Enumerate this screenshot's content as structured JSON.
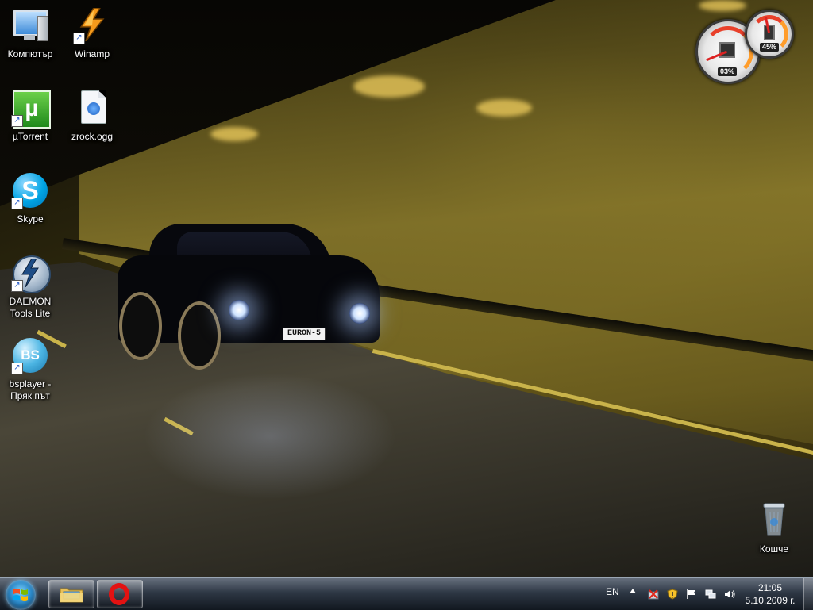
{
  "desktop": {
    "icons": [
      {
        "label": "Компютър",
        "icon": "computer-icon"
      },
      {
        "label": "Winamp",
        "icon": "winamp-icon"
      },
      {
        "label": "µTorrent",
        "icon": "utorrent-icon",
        "glyph": "µ"
      },
      {
        "label": "zrock.ogg",
        "icon": "audio-file-icon"
      },
      {
        "label": "Skype",
        "icon": "skype-icon",
        "glyph": "S"
      },
      {
        "label": "DAEMON Tools Lite",
        "icon": "daemon-tools-icon"
      },
      {
        "label": "bsplayer - Пряк път",
        "icon": "bsplayer-icon",
        "glyph": "BS"
      },
      {
        "label": "Кошче",
        "icon": "recycle-bin-icon"
      }
    ],
    "wallpaper": {
      "plate_text": "EURON-5"
    }
  },
  "gadget": {
    "cpu_value": "03%",
    "memory_value": "45%",
    "cpu_percent": 3,
    "memory_percent": 45
  },
  "taskbar": {
    "start": {
      "icon": "windows-logo-icon"
    },
    "pinned": [
      {
        "name": "Windows Explorer",
        "icon": "folder-icon"
      },
      {
        "name": "Opera",
        "icon": "opera-icon"
      }
    ],
    "language": "EN",
    "tray_icons": [
      "show-hidden-icons",
      "network-error-icon",
      "warning-shield-icon",
      "action-center-flag-icon",
      "network-icon",
      "volume-icon"
    ],
    "clock": {
      "time": "21:05",
      "date": "5.10.2009 г."
    }
  },
  "colors": {
    "accent": "#2a88c8",
    "opera_red": "#e21212",
    "utorrent_green": "#1f8a1b",
    "gauge_red": "#e8402a"
  }
}
